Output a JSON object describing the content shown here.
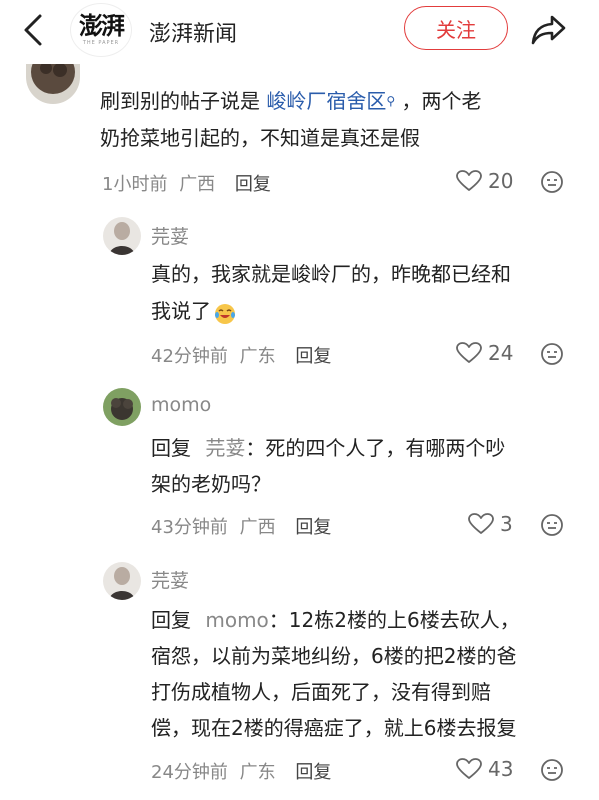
{
  "header": {
    "title": "澎湃新闻",
    "logo_text": "澎湃",
    "logo_sub": "THE PAPER",
    "follow_label": "关注"
  },
  "comments": [
    {
      "user": "",
      "line1_pre": "刷到别的帖子说是 ",
      "link_text": "峻岭厂宿舍区",
      "line1_post": " ，两个老",
      "line2": "奶抢菜地引起的，不知道是真还是假",
      "time": "1小时前",
      "location": "广西",
      "reply": "回复",
      "likes": "20"
    },
    {
      "user": "芫荽",
      "lines": [
        "真的，我家就是峻岭厂的，昨晚都已经和",
        "我说了"
      ],
      "time": "42分钟前",
      "location": "广东",
      "reply": "回复",
      "likes": "24"
    },
    {
      "user": "momo",
      "reply_prefix": "回复",
      "mention": "芫荽",
      "line1": "：死的四个人了，有哪两个吵",
      "line2": "架的老奶吗？",
      "time": "43分钟前",
      "location": "广西",
      "reply": "回复",
      "likes": "3"
    },
    {
      "user": "芫荽",
      "reply_prefix": "回复",
      "mention": "momo",
      "line1": "：12栋2楼的上6楼去砍人，",
      "lines": [
        "宿怨，以前为菜地纠纷，6楼的把2楼的爸",
        "打伤成植物人，后面死了，没有得到赔",
        "偿，现在2楼的得癌症了，就上6楼去报复"
      ],
      "time": "24分钟前",
      "location": "广东",
      "reply": "回复",
      "likes": "43"
    }
  ],
  "colors": {
    "accent": "#e23c3c",
    "link": "#2a5cab",
    "meta": "#888888"
  },
  "icons": [
    "back-chevron",
    "share-arrow",
    "heart-outline",
    "emoji-face",
    "search-small",
    "laughing-crying-emoji"
  ]
}
